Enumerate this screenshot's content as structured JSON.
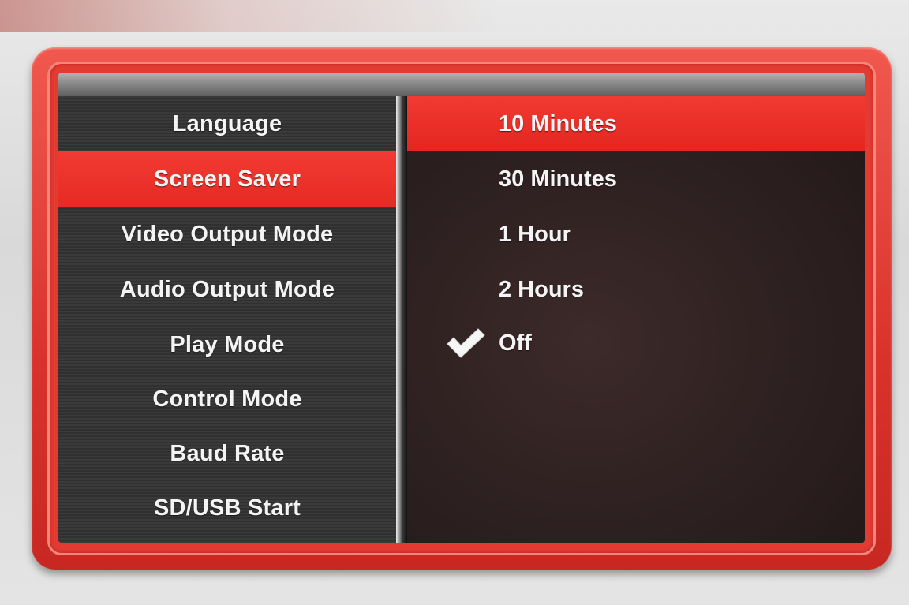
{
  "menu": {
    "items": [
      {
        "label": "Language",
        "selected": false
      },
      {
        "label": "Screen Saver",
        "selected": true
      },
      {
        "label": "Video Output Mode",
        "selected": false
      },
      {
        "label": "Audio Output Mode",
        "selected": false
      },
      {
        "label": "Play Mode",
        "selected": false
      },
      {
        "label": "Control Mode",
        "selected": false
      },
      {
        "label": "Baud Rate",
        "selected": false
      },
      {
        "label": "SD/USB Start",
        "selected": false
      }
    ]
  },
  "options": {
    "items": [
      {
        "label": "10 Minutes",
        "highlighted": true,
        "checked": false
      },
      {
        "label": "30 Minutes",
        "highlighted": false,
        "checked": false
      },
      {
        "label": "1 Hour",
        "highlighted": false,
        "checked": false
      },
      {
        "label": "2 Hours",
        "highlighted": false,
        "checked": false
      },
      {
        "label": "Off",
        "highlighted": false,
        "checked": true
      }
    ],
    "check_icon": "checkmark-icon"
  },
  "colors": {
    "accent_red": "#e62a24",
    "frame_red": "#d9322b",
    "panel_dark": "#2b2626",
    "text": "#f4f4f4"
  }
}
